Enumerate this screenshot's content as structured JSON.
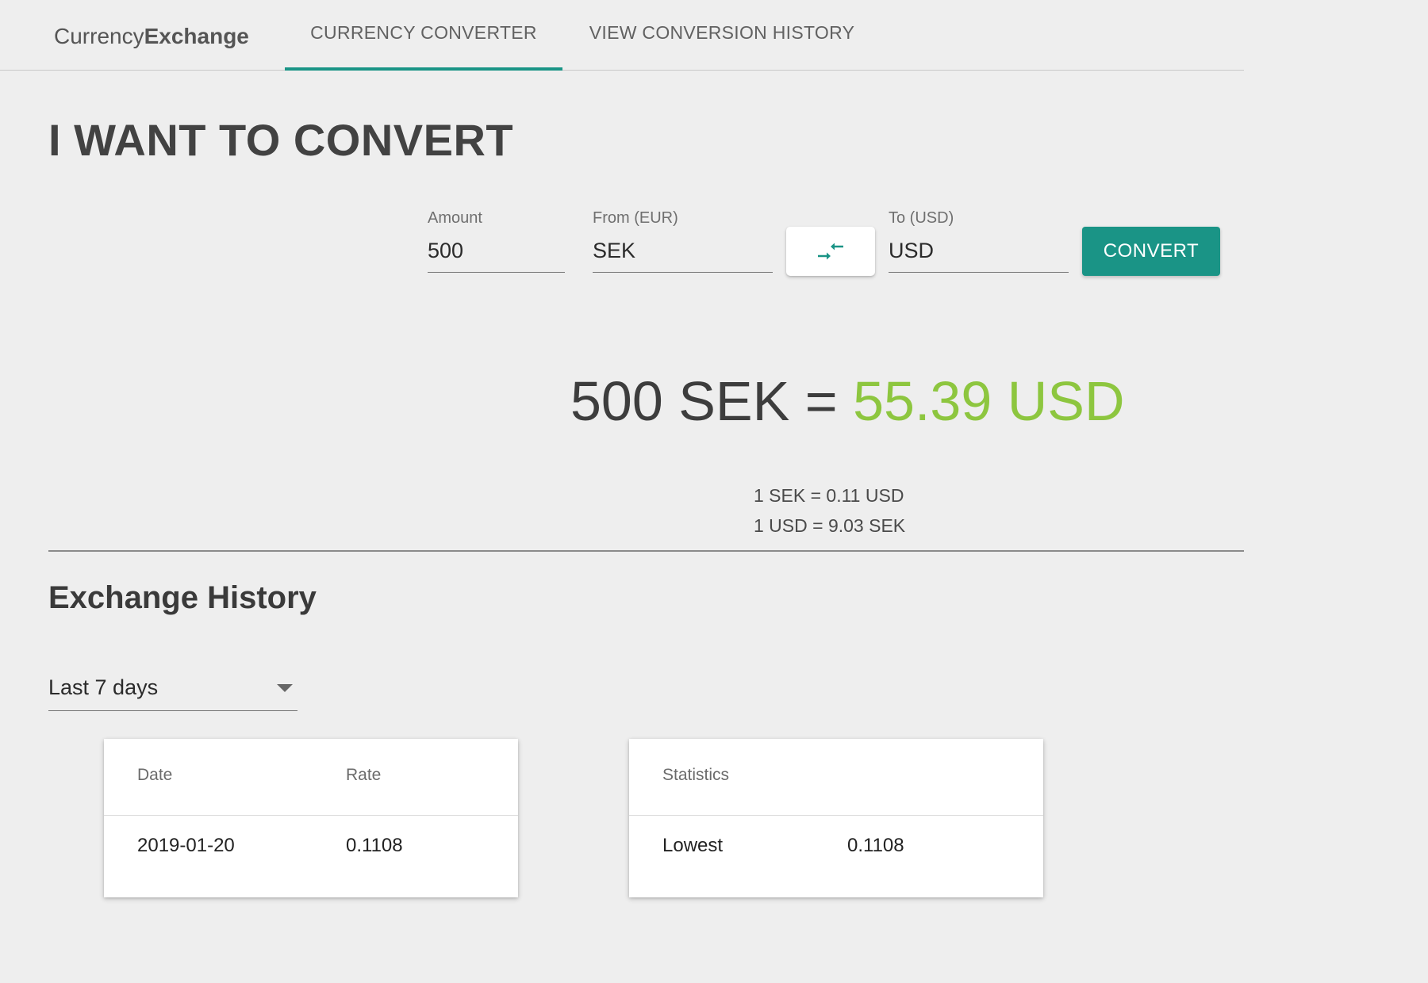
{
  "brand": {
    "part1": "Currency",
    "part2": "Exchange"
  },
  "tabs": [
    {
      "label": "CURRENCY CONVERTER",
      "active": true
    },
    {
      "label": "VIEW CONVERSION HISTORY",
      "active": false
    }
  ],
  "converter": {
    "title": "I WANT TO CONVERT",
    "amount_label": "Amount",
    "amount_value": "500",
    "from_label": "From (EUR)",
    "from_value": "SEK",
    "to_label": "To (USD)",
    "to_value": "USD",
    "swap_icon": "swap-arrows-icon",
    "convert_label": "CONVERT",
    "accent_color": "#1a9486"
  },
  "result": {
    "from_text": "500 SEK =",
    "to_text": "55.39 USD",
    "to_color": "#8dc63f",
    "rate_1": "1 SEK = 0.11 USD",
    "rate_2": "1 USD = 9.03 SEK"
  },
  "history": {
    "title": "Exchange History",
    "period_selected": "Last 7 days",
    "table": {
      "columns": [
        "Date",
        "Rate"
      ],
      "rows": [
        [
          "2019-01-20",
          "0.1108"
        ]
      ]
    },
    "statistics": {
      "header": "Statistics",
      "rows": [
        [
          "Lowest",
          "0.1108"
        ]
      ]
    }
  }
}
